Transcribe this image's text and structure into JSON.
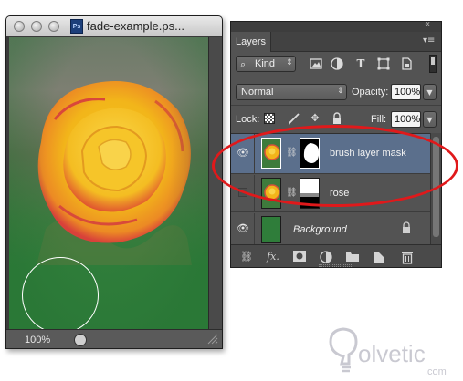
{
  "document_window": {
    "title": "fade-example.ps...",
    "file_icon_text": "Ps",
    "zoom": "100%",
    "icons": [
      "close-dot",
      "minimize-dot",
      "zoom-dot",
      "photoshop-file-icon",
      "brush-cursor",
      "status-menu-icon"
    ]
  },
  "layers_panel": {
    "tab_label": "Layers",
    "filter": {
      "kind_label": "Kind",
      "buttons": [
        "pixel-layer-filter",
        "adjustment-filter",
        "type-filter",
        "shape-filter",
        "smart-object-filter"
      ]
    },
    "blend_mode": "Normal",
    "opacity_label": "Opacity:",
    "opacity_value": "100%",
    "lock_label": "Lock:",
    "fill_label": "Fill:",
    "fill_value": "100%",
    "layers": [
      {
        "name": "brush layer mask",
        "visible": true,
        "selected": true
      },
      {
        "name": "rose",
        "visible": false,
        "selected": false
      },
      {
        "name": "Background",
        "visible": true,
        "selected": false,
        "locked": true
      }
    ],
    "footer_icons": [
      "link-layers",
      "fx",
      "add-mask",
      "adjustment-layer",
      "new-group",
      "new-layer",
      "delete"
    ]
  },
  "annotation": {
    "color": "#e0191b"
  },
  "watermark": {
    "text": "olvetic",
    "subtext": ".com"
  },
  "colors": {
    "panel_bg": "#535353",
    "selected_row": "#5b6f8c",
    "canvas_green": "#2f7d3a"
  }
}
